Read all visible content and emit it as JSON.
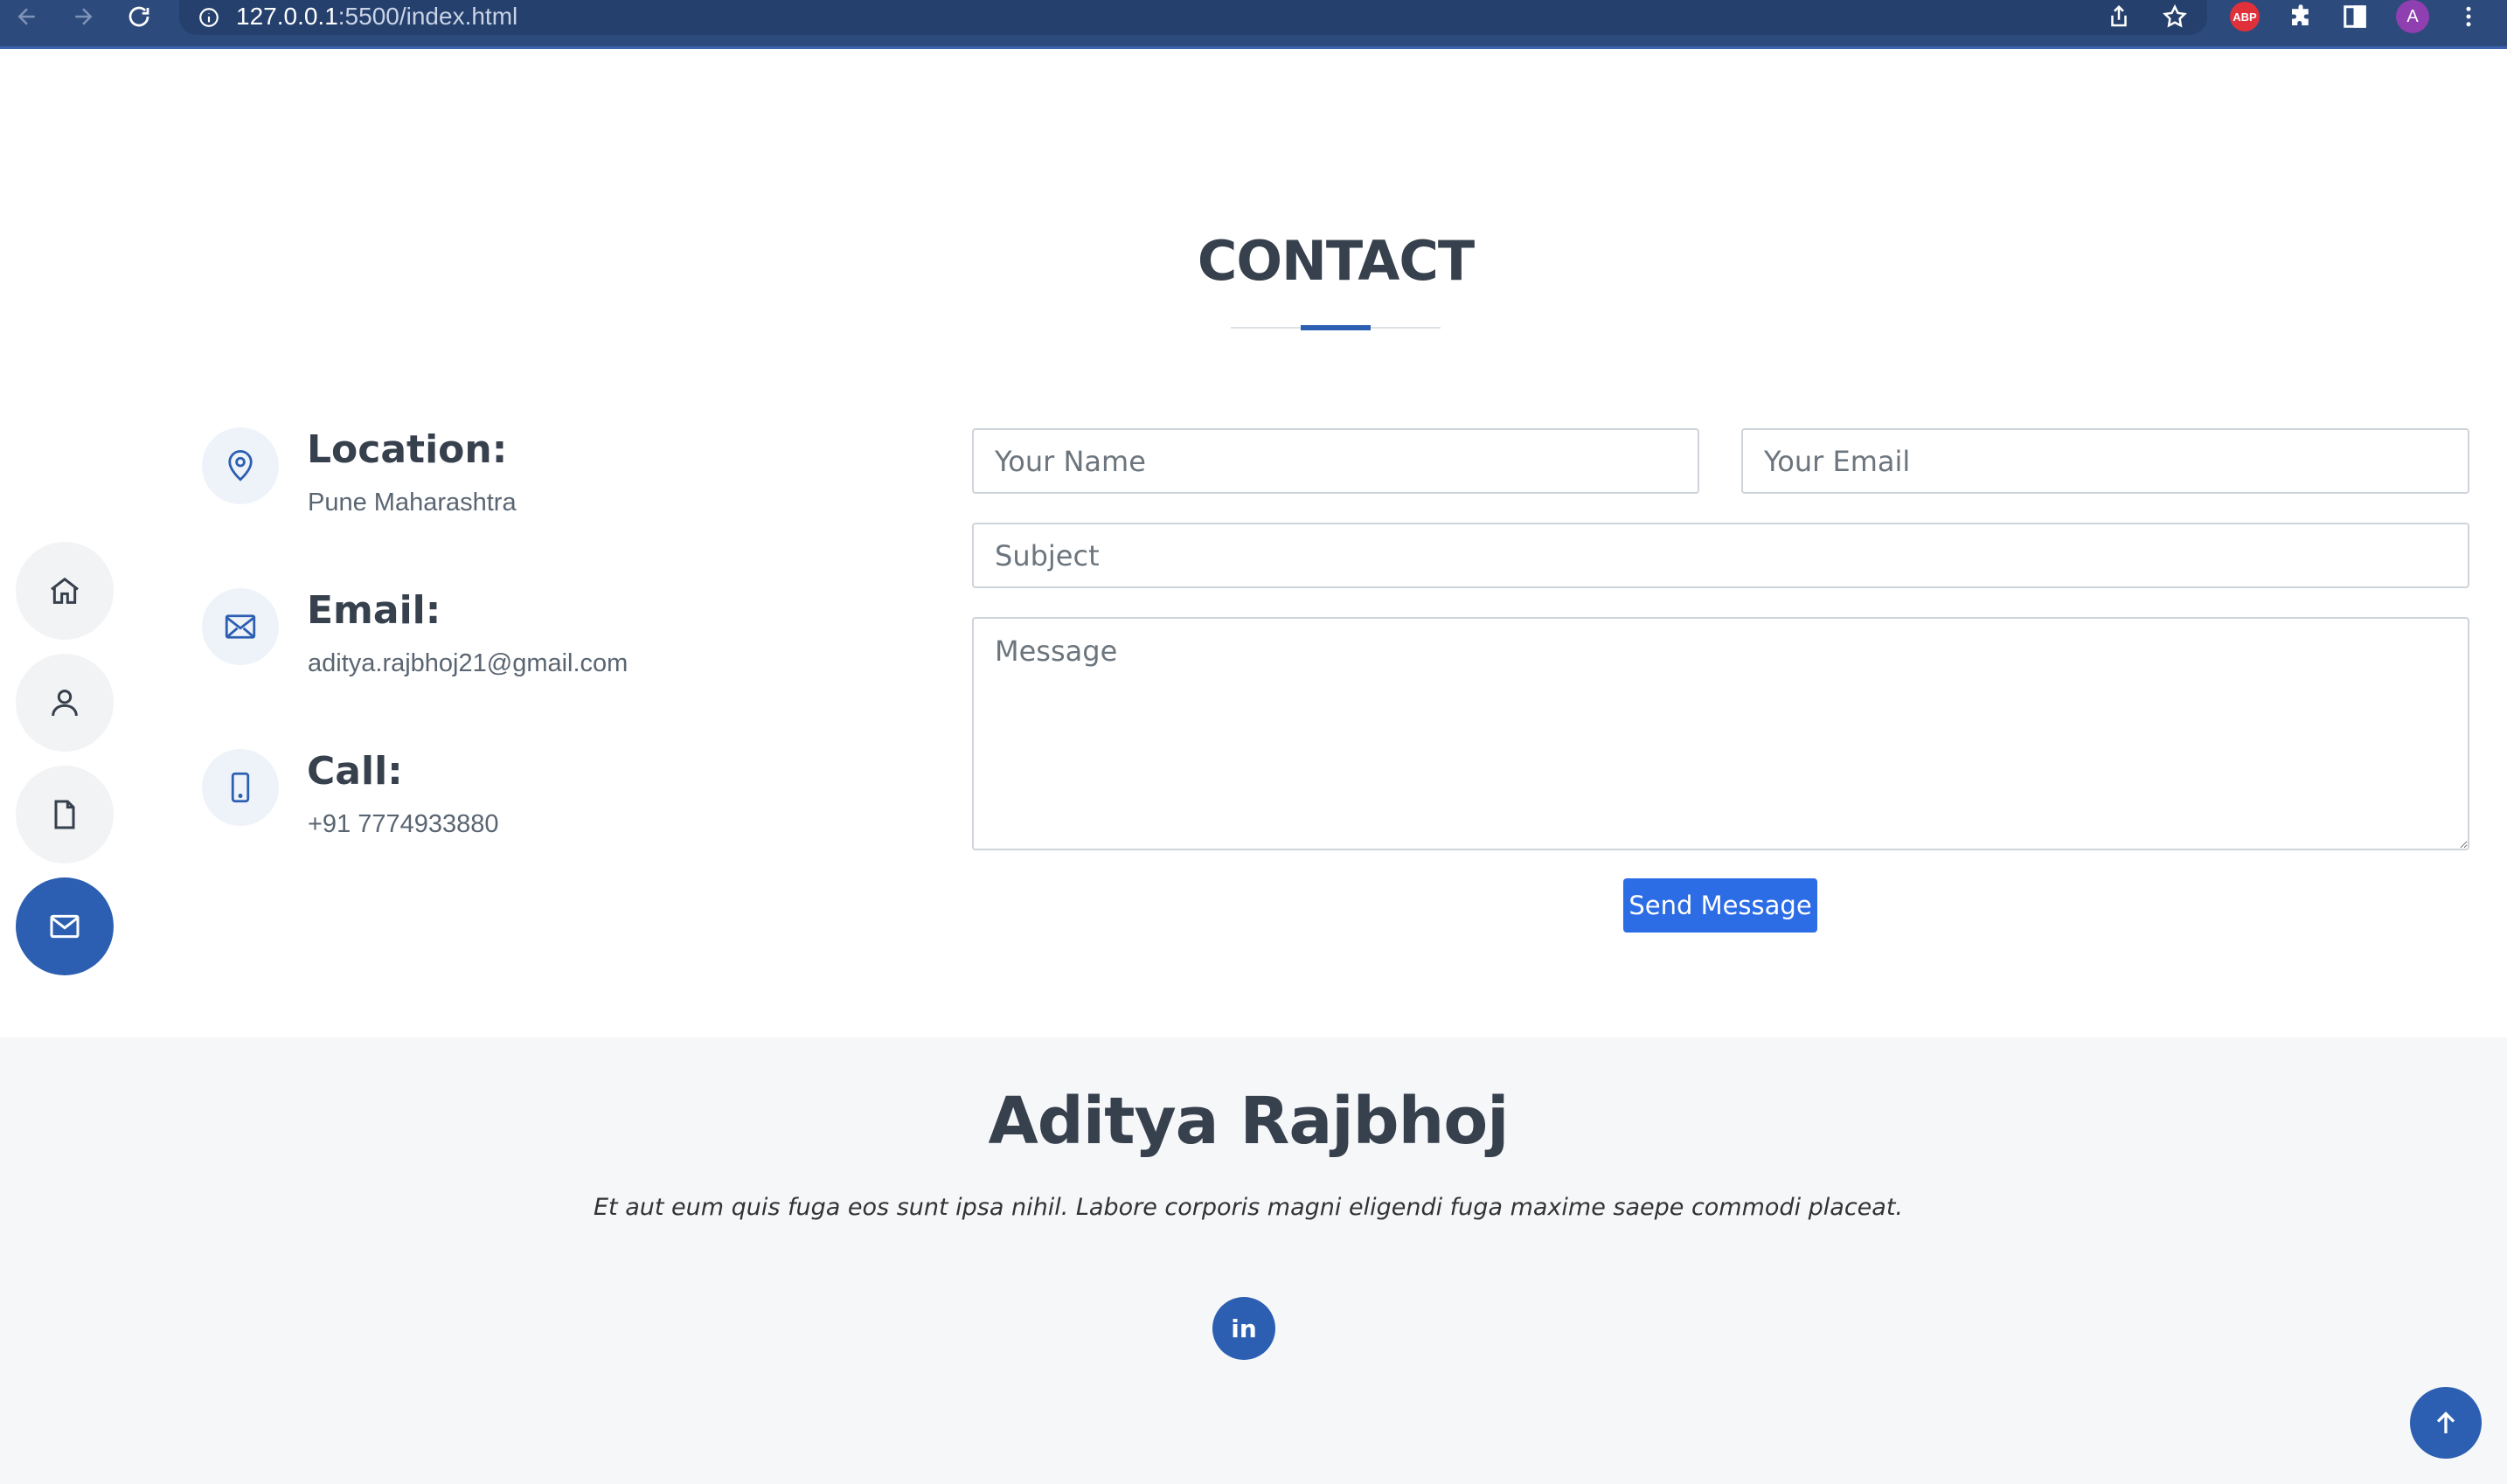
{
  "browser": {
    "url_host": "127.0.0.1",
    "url_path": ":5500/index.html",
    "adblock_badge": "ABP",
    "profile_initial": "A"
  },
  "side_nav": {
    "items": [
      {
        "name": "home",
        "icon": "house-icon",
        "active": false
      },
      {
        "name": "about",
        "icon": "person-icon",
        "active": false
      },
      {
        "name": "resume",
        "icon": "file-icon",
        "active": false
      },
      {
        "name": "contact",
        "icon": "envelope-icon",
        "active": true
      }
    ]
  },
  "contact": {
    "title": "CONTACT",
    "location": {
      "label": "Location:",
      "value": "Pune Maharashtra"
    },
    "email": {
      "label": "Email:",
      "value": "aditya.rajbhoj21@gmail.com"
    },
    "call": {
      "label": "Call:",
      "value": "+91 7774933880"
    },
    "form": {
      "name_placeholder": "Your Name",
      "email_placeholder": "Your Email",
      "subject_placeholder": "Subject",
      "message_placeholder": "Message",
      "submit_label": "Send Message"
    }
  },
  "footer": {
    "name": "Aditya Rajbhoj",
    "tagline": "Et aut eum quis fuga eos sunt ipsa nihil. Labore corporis magni eligendi fuga maxime saepe commodi placeat.",
    "social": [
      {
        "name": "linkedin",
        "label": "in"
      }
    ]
  },
  "colors": {
    "accent": "#2c5fb2",
    "button": "#2c6de6",
    "heading": "#37404d",
    "footer_bg": "#f6f7f9"
  }
}
